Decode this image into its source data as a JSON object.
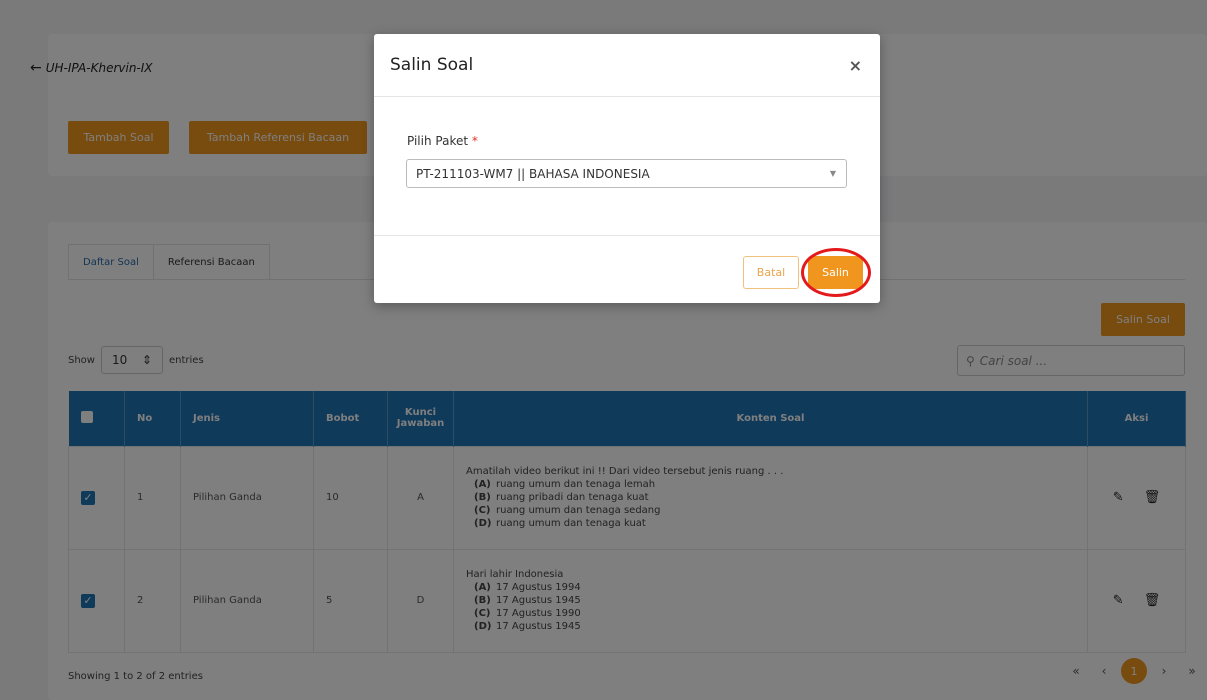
{
  "page": {
    "back_label": "UH-IPA-Khervin-IX",
    "buttons": {
      "tambah_soal": "Tambah Soal",
      "tambah_referensi": "Tambah Referensi Bacaan",
      "salin_soal": "Salin Soal"
    },
    "tabs": [
      {
        "label": "Daftar Soal",
        "active": true
      },
      {
        "label": "Referensi Bacaan",
        "active": false
      }
    ],
    "length": {
      "show": "Show",
      "value": "10",
      "entries": "entries"
    },
    "search": {
      "placeholder": "Cari soal ..."
    },
    "table": {
      "headers": {
        "no": "No",
        "jenis": "Jenis",
        "bobot": "Bobot",
        "kunci": "Kunci Jawaban",
        "konten": "Konten Soal",
        "aksi": "Aksi"
      },
      "rows": [
        {
          "no": "1",
          "jenis": "Pilihan Ganda",
          "bobot": "10",
          "kunci": "A",
          "checked": true,
          "question": "Amatilah video berikut ini !!   Dari video tersebut jenis ruang . . .",
          "options": [
            {
              "label": "(A)",
              "text": "ruang umum dan tenaga lemah"
            },
            {
              "label": "(B)",
              "text": "ruang pribadi dan tenaga kuat"
            },
            {
              "label": "(C)",
              "text": "ruang umum dan tenaga sedang"
            },
            {
              "label": "(D)",
              "text": "ruang umum dan tenaga kuat"
            }
          ]
        },
        {
          "no": "2",
          "jenis": "Pilihan Ganda",
          "bobot": "5",
          "kunci": "D",
          "checked": true,
          "question": "Hari lahir Indonesia",
          "options": [
            {
              "label": "(A)",
              "text": "17 Agustus 1994"
            },
            {
              "label": "(B)",
              "text": "17 Agustus 1945"
            },
            {
              "label": "(C)",
              "text": "17 Agustus 1990"
            },
            {
              "label": "(D)",
              "text": "17 Agustus 1945"
            }
          ]
        }
      ]
    },
    "footer": {
      "info": "Showing 1 to 2 of 2 entries",
      "current_page": "1",
      "first": "«",
      "prev": "‹",
      "next": "›",
      "last": "»"
    }
  },
  "modal": {
    "title": "Salin Soal",
    "close": "×",
    "field_label": "Pilih Paket",
    "required_mark": "*",
    "selected_value": "PT-211103-WM7 || BAHASA INDONESIA",
    "cancel": "Batal",
    "confirm": "Salin"
  },
  "colors": {
    "accent": "#f0961e",
    "table_header": "#1f74b5",
    "highlight": "#e4191b"
  }
}
